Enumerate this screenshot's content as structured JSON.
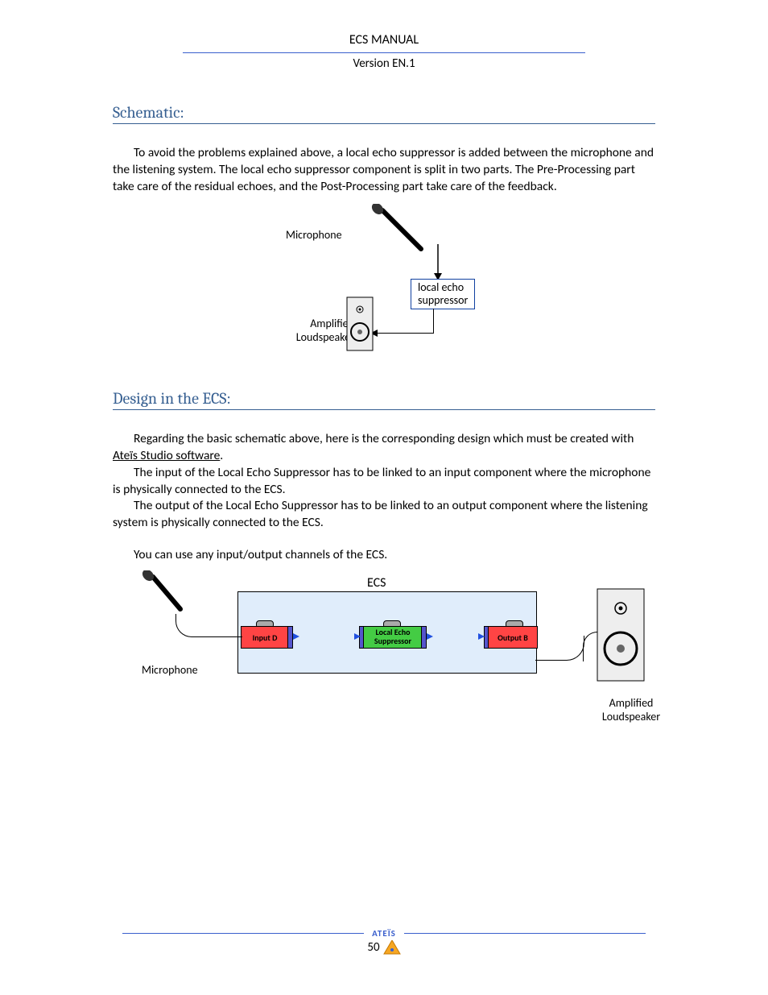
{
  "header": {
    "title": "ECS  MANUAL",
    "version": "Version EN.1"
  },
  "sections": {
    "schematic": {
      "heading": "Schematic:",
      "para1": "To avoid the problems explained above, a local echo suppressor is added between the microphone and the listening system. The local echo suppressor component is split in two parts. The Pre-Processing part take care of the residual echoes, and the Post-Processing part take care of the feedback."
    },
    "design": {
      "heading": "Design in the ECS:",
      "p1_a": "Regarding the basic schematic above, here is the corresponding design which must be created with ",
      "p1_u": "Ateïs Studio software",
      "p1_b": ".",
      "p2": "The input of the Local Echo Suppressor has to be linked to an input component where the microphone is physically connected to the ECS.",
      "p3": "The output of the Local Echo Suppressor has to be linked to an output component where the listening system is physically connected to the ECS.",
      "p4": "You can use any input/output channels of the ECS."
    }
  },
  "diagram1": {
    "mic_label": "Microphone",
    "amp_label": "Amplified Loudspeaker",
    "box_line1": "local echo",
    "box_line2": "suppressor"
  },
  "diagram2": {
    "ecs": "ECS",
    "input": "Input D",
    "les_l1": "Local Echo",
    "les_l2": "Suppressor",
    "output": "Output B",
    "mic_label": "Microphone",
    "amp_label": "Amplified Loudspeaker"
  },
  "footer": {
    "brand": "ATEÏS",
    "page": "50"
  }
}
